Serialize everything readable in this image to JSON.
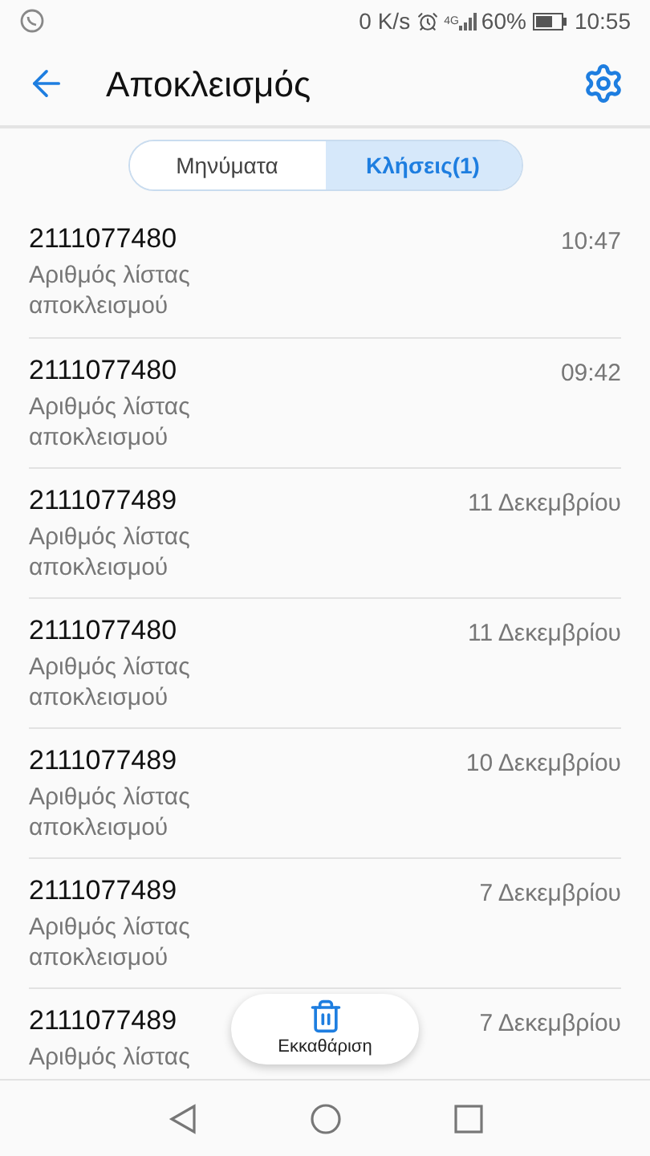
{
  "status_bar": {
    "speed": "0 K/s",
    "network": "4G",
    "battery": "60%",
    "time": "10:55"
  },
  "app_bar": {
    "title": "Αποκλεισμός"
  },
  "tabs": [
    {
      "label": "Μηνύματα",
      "selected": false
    },
    {
      "label": "Κλήσεις(1)",
      "selected": true
    }
  ],
  "calls": [
    {
      "number": "2111077480",
      "label": "Αριθμός λίστας αποκλεισμού",
      "time": "10:47"
    },
    {
      "number": "2111077480",
      "label": "Αριθμός λίστας αποκλεισμού",
      "time": "09:42"
    },
    {
      "number": "2111077489",
      "label": "Αριθμός λίστας αποκλεισμού",
      "time": "11 Δεκεμβρίου"
    },
    {
      "number": "2111077480",
      "label": "Αριθμός λίστας αποκλεισμού",
      "time": "11 Δεκεμβρίου"
    },
    {
      "number": "2111077489",
      "label": "Αριθμός λίστας αποκλεισμού",
      "time": "10 Δεκεμβρίου"
    },
    {
      "number": "2111077489",
      "label": "Αριθμός λίστας αποκλεισμού",
      "time": "7 Δεκεμβρίου"
    },
    {
      "number": "2111077489",
      "label": "Αριθμός λίστας",
      "time": "7 Δεκεμβρίου"
    }
  ],
  "clear_button": {
    "label": "Εκκαθάριση"
  }
}
